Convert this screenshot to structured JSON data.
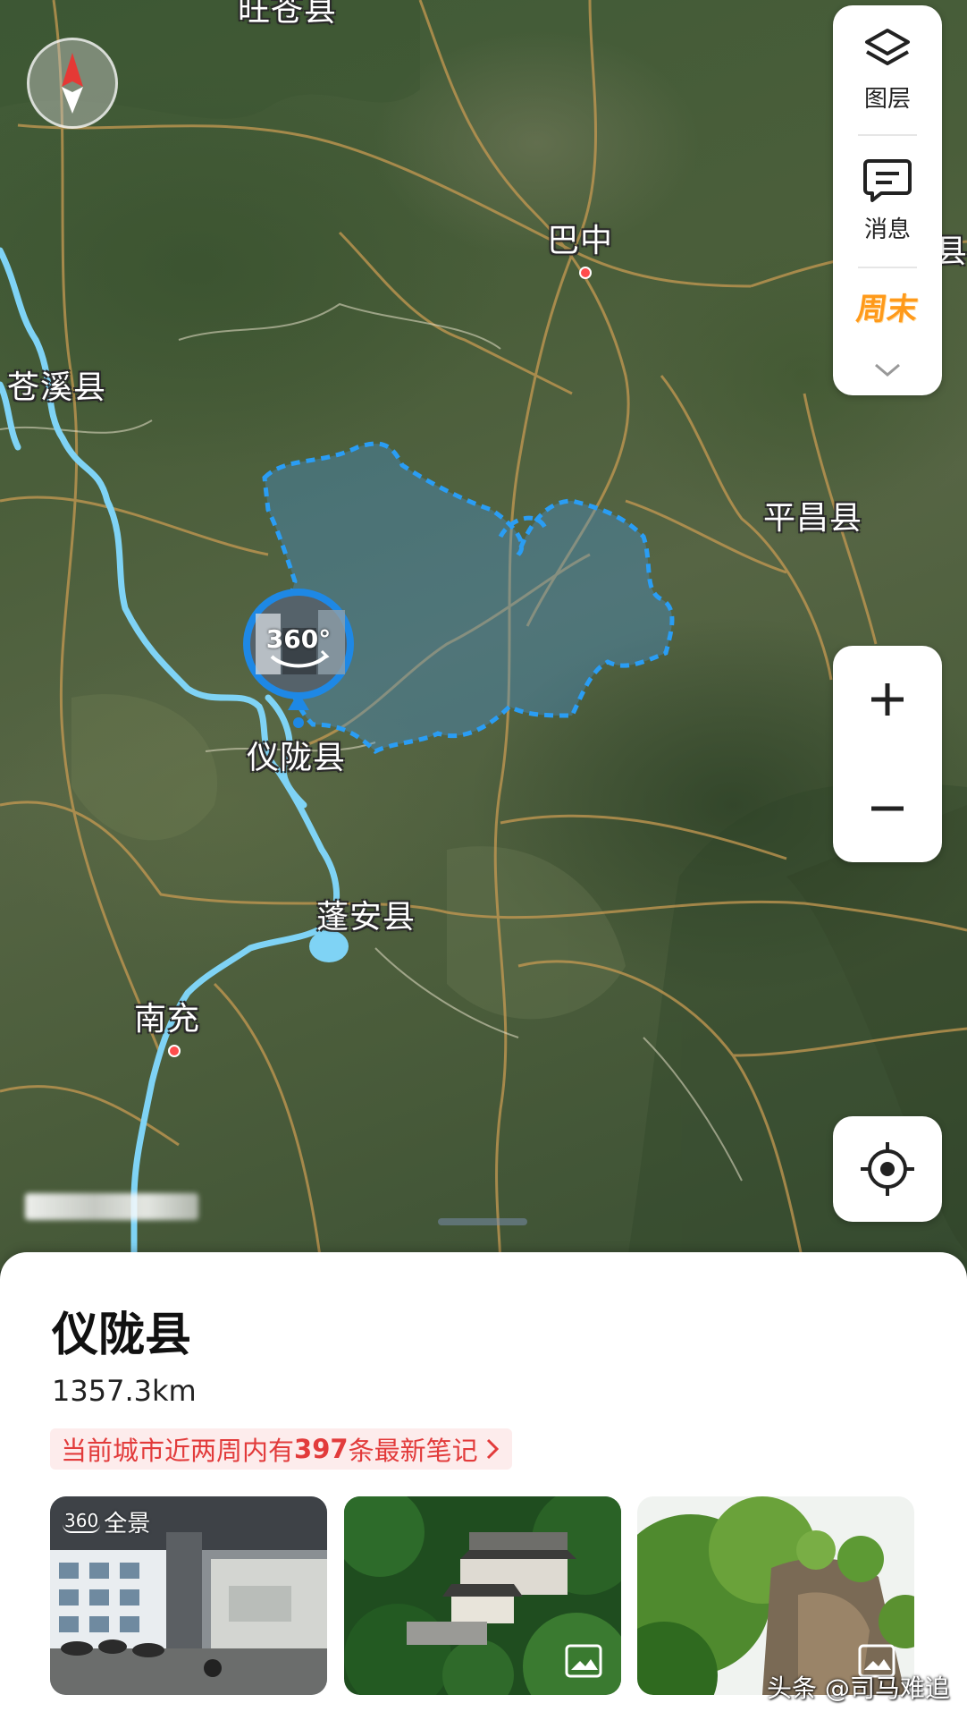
{
  "map": {
    "labels": {
      "wangcang": "旺苍县",
      "bazhong": "巴中",
      "cangxi": "苍溪县",
      "pingchang": "平昌县",
      "yilong": "仪陇县",
      "pengan": "蓬安县",
      "nanchong": "南充",
      "edge_right": "县"
    },
    "pano_marker_text": "360°",
    "colors": {
      "boundary": "#2a9df4",
      "river": "#7fd3f5",
      "road": "#c79a52",
      "city_dot": "#ff4d4d"
    }
  },
  "tools": {
    "layers_label": "图层",
    "messages_label": "消息",
    "weekend_label": "周末",
    "more_icon": "chevron-down-icon"
  },
  "zoom": {
    "in_icon": "plus-icon",
    "out_icon": "minus-icon"
  },
  "locate_icon": "locate-icon",
  "place": {
    "name": "仪陇县",
    "distance": "1357.3km",
    "notes_prefix": "当前城市近两周内有",
    "notes_count": "397",
    "notes_suffix": "条最新笔记"
  },
  "photos": [
    {
      "tag_icon": "360",
      "tag_label": "全景",
      "kind": "panorama"
    },
    {
      "kind": "image",
      "icon": "image-icon"
    },
    {
      "kind": "image",
      "icon": "image-icon"
    }
  ],
  "watermark": "头条 @司马难追"
}
